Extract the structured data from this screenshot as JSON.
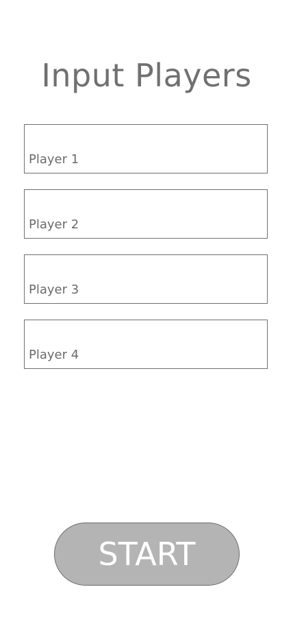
{
  "page": {
    "title": "Input Players"
  },
  "players": [
    {
      "placeholder": "Player 1",
      "value": ""
    },
    {
      "placeholder": "Player 2",
      "value": ""
    },
    {
      "placeholder": "Player 3",
      "value": ""
    },
    {
      "placeholder": "Player 4",
      "value": ""
    }
  ],
  "actions": {
    "start_label": "START"
  },
  "colors": {
    "button_fill": "#b4b4b4",
    "text_gray": "#707070",
    "border": "#6f6f6f"
  }
}
